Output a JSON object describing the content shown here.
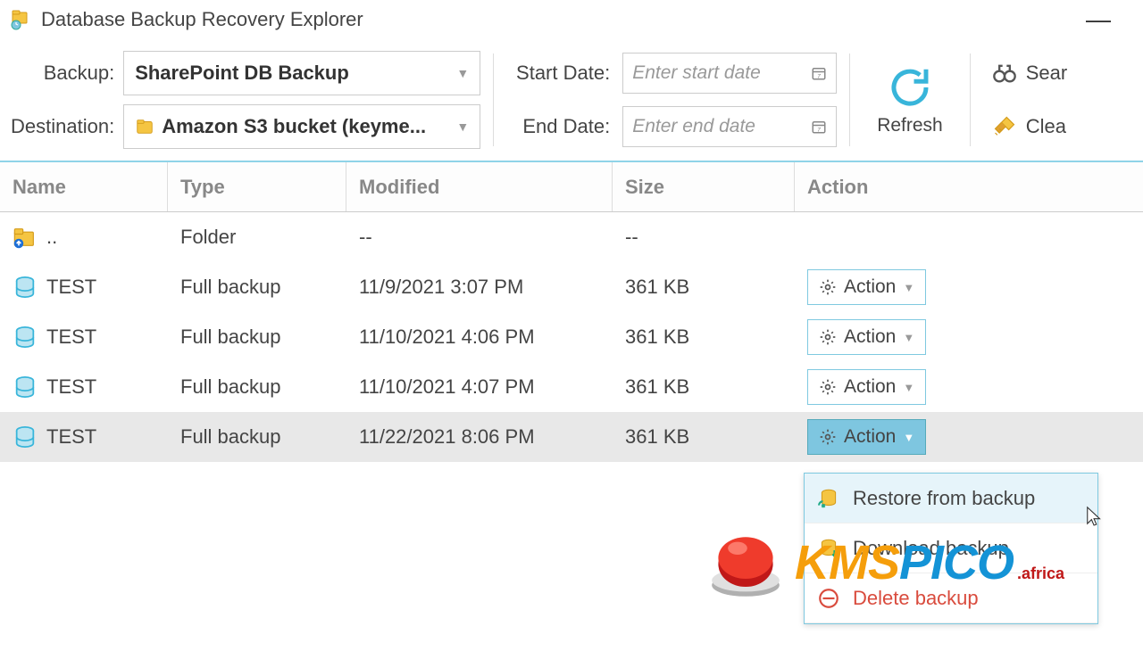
{
  "window": {
    "title": "Database Backup Recovery Explorer"
  },
  "toolbar": {
    "backup_label": "Backup:",
    "backup_value": "SharePoint DB Backup",
    "dest_label": "Destination:",
    "dest_value": "Amazon S3 bucket (keyme...",
    "start_label": "Start Date:",
    "start_placeholder": "Enter start date",
    "end_label": "End Date:",
    "end_placeholder": "Enter end date",
    "refresh_label": "Refresh",
    "search_label": "Sear",
    "clear_label": "Clea"
  },
  "grid": {
    "cols": {
      "name": "Name",
      "type": "Type",
      "modified": "Modified",
      "size": "Size",
      "action": "Action"
    },
    "action_btn_label": "Action",
    "rows": [
      {
        "icon": "folder-up",
        "name": "..",
        "type": "Folder",
        "modified": "--",
        "size": "--",
        "action": false,
        "selected": false
      },
      {
        "icon": "db",
        "name": "TEST",
        "type": "Full backup",
        "modified": "11/9/2021 3:07 PM",
        "size": "361 KB",
        "action": true,
        "selected": false
      },
      {
        "icon": "db",
        "name": "TEST",
        "type": "Full backup",
        "modified": "11/10/2021 4:06 PM",
        "size": "361 KB",
        "action": true,
        "selected": false
      },
      {
        "icon": "db",
        "name": "TEST",
        "type": "Full backup",
        "modified": "11/10/2021 4:07 PM",
        "size": "361 KB",
        "action": true,
        "selected": false
      },
      {
        "icon": "db",
        "name": "TEST",
        "type": "Full backup",
        "modified": "11/22/2021 8:06 PM",
        "size": "361 KB",
        "action": true,
        "selected": true
      }
    ]
  },
  "dropdown": {
    "restore": "Restore from backup",
    "download": "Download backup",
    "delete": "Delete backup"
  },
  "watermark": {
    "text1": "KMS",
    "text2": "PICO",
    "suffix": ".africa"
  }
}
